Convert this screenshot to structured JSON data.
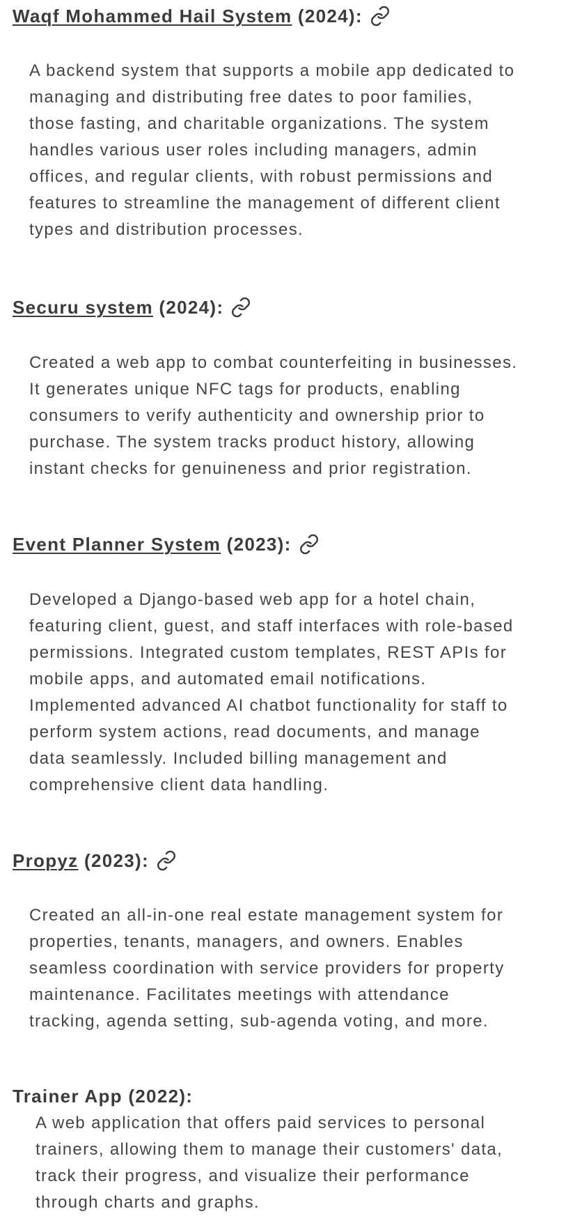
{
  "projects": [
    {
      "name": "Waqf Mohammed Hail System",
      "year_suffix": " (2024):",
      "has_link": true,
      "description": " A backend system that supports a mobile app dedicated to\nmanaging and distributing free dates to poor families,\nthose fasting, and charitable organizations. The system\nhandles various user roles including managers, admin\noffices, and regular clients, with robust permissions and\nfeatures to streamline the management of different client\ntypes and distribution processes."
    },
    {
      "name": "Securu system",
      "year_suffix": " (2024):",
      "has_link": true,
      "description": " Created a web app to combat counterfeiting in businesses.\nIt generates unique NFC tags for products, enabling\nconsumers to verify authenticity and ownership prior to\npurchase. The system tracks product history, allowing\ninstant checks for genuineness and prior registration."
    },
    {
      "name": "Event Planner System",
      "year_suffix": " (2023):",
      "has_link": true,
      "description": " Developed a Django-based web app for a hotel chain,\nfeaturing client, guest, and staff interfaces with role-based\npermissions. Integrated custom templates, REST APIs for\nmobile apps, and automated email notifications.\nImplemented advanced AI chatbot functionality for staff to\nperform system actions, read documents, and manage\ndata seamlessly. Included billing management and\ncomprehensive client data handling."
    },
    {
      "name": "Propyz",
      "year_suffix": " (2023):",
      "has_link": true,
      "description": " Created an all-in-one real estate management system for\nproperties, tenants, managers, and owners. Enables\nseamless coordination with service providers for property\nmaintenance. Facilitates meetings with attendance\ntracking, agenda setting, sub-agenda voting, and more."
    },
    {
      "name": "Trainer App",
      "year_suffix": " (2022):",
      "has_link": false,
      "description": " A web application that offers paid services to personal\ntrainers, allowing them to manage their customers' data,\ntrack their progress, and visualize their performance\nthrough charts and graphs."
    }
  ],
  "icons": {
    "link": "link-icon"
  },
  "colors": {
    "text": "#3b3b3b",
    "body_text": "#454545",
    "background": "#ffffff"
  }
}
